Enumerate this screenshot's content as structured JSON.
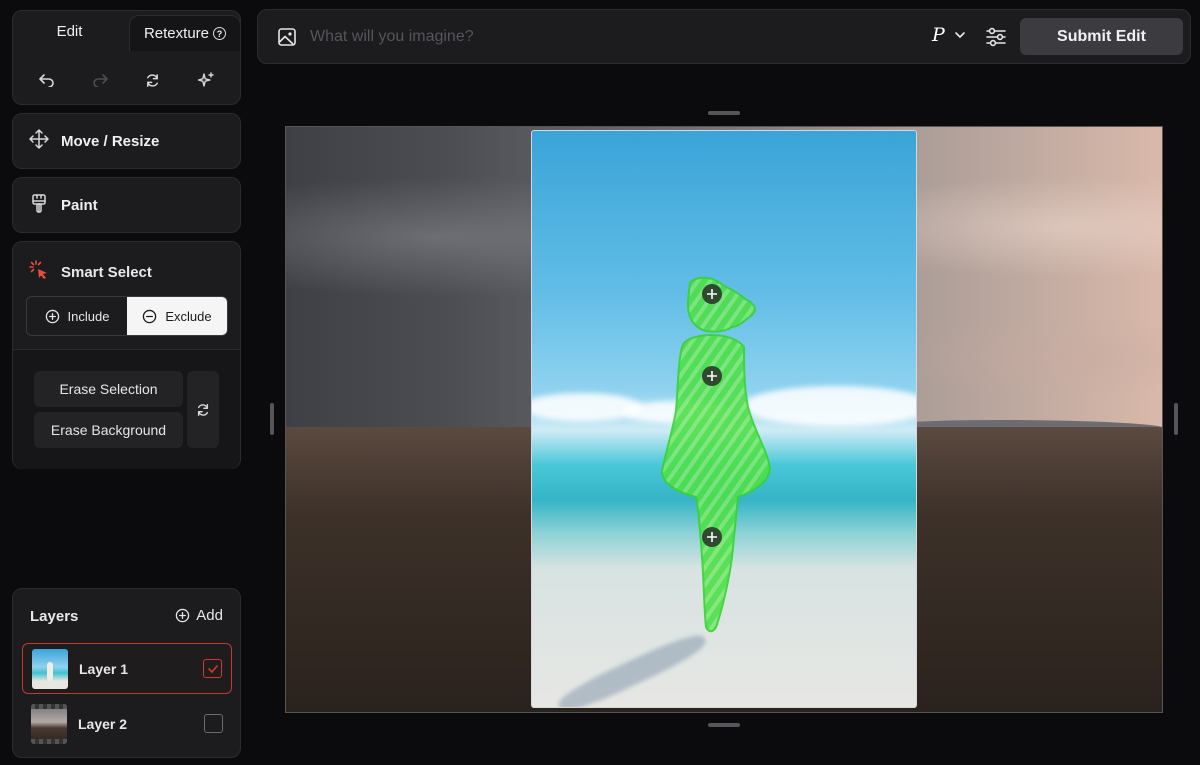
{
  "edit_panel": {
    "tab_edit": "Edit",
    "tab_retexture": "Retexture",
    "tools": [
      "undo-icon",
      "redo-icon",
      "refresh-icon",
      "sparkle-icon"
    ]
  },
  "tools": {
    "move_resize": "Move / Resize",
    "paint": "Paint",
    "smart_select": "Smart Select",
    "include": "Include",
    "exclude": "Exclude",
    "erase_selection": "Erase Selection",
    "erase_background": "Erase Background",
    "mode": "exclude"
  },
  "layers": {
    "title": "Layers",
    "add_label": "Add",
    "items": [
      {
        "name": "Layer 1",
        "checked": true,
        "selected": true
      },
      {
        "name": "Layer 2",
        "checked": false,
        "selected": false
      }
    ]
  },
  "topbar": {
    "prompt_placeholder": "What will you imagine?",
    "prompt_value": "",
    "model_label": "P",
    "submit_label": "Submit Edit"
  },
  "colors": {
    "accent_red": "#d0392b",
    "selection_green": "#3ee23e",
    "panel_bg": "#1c1c1f",
    "page_bg": "#0b0b0d"
  }
}
